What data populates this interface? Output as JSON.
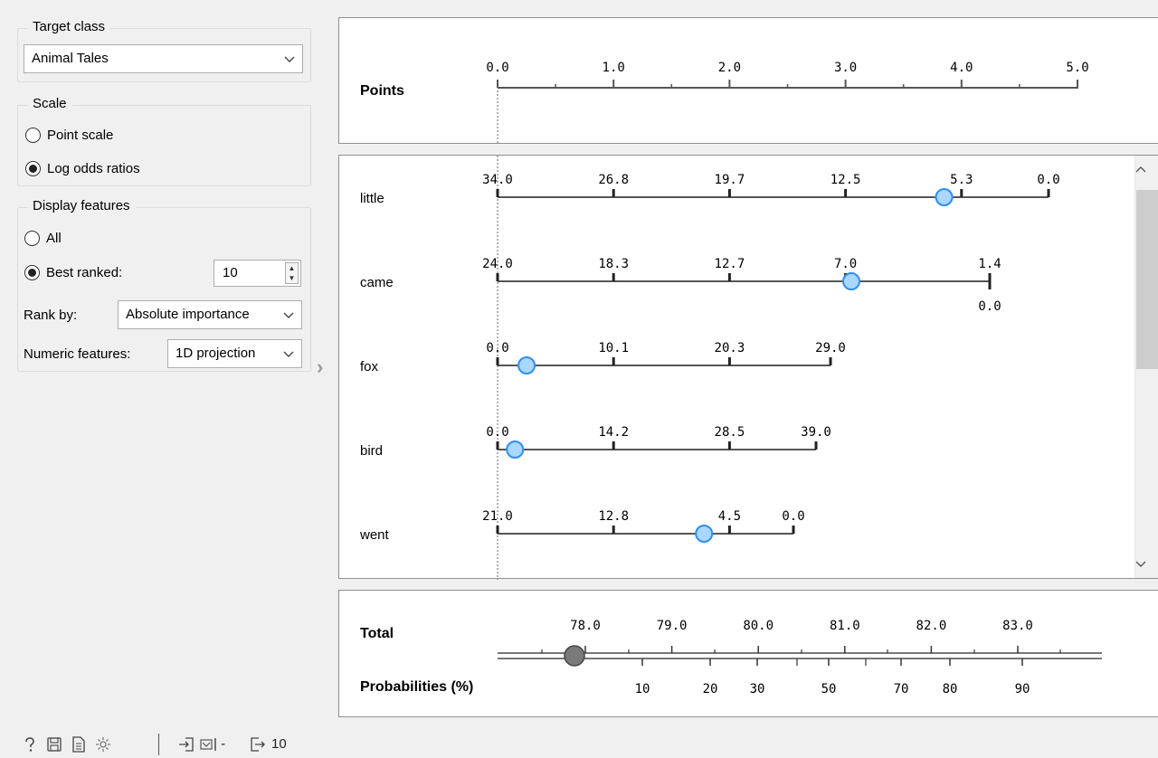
{
  "target_class": {
    "title": "Target class",
    "value": "Animal Tales"
  },
  "scale": {
    "title": "Scale",
    "options": [
      {
        "label": "Point scale",
        "checked": false
      },
      {
        "label": "Log odds ratios",
        "checked": true
      }
    ]
  },
  "display_features": {
    "title": "Display features",
    "all_label": "All",
    "best_ranked_label": "Best ranked:",
    "best_ranked_value": "10",
    "rank_by_label": "Rank by:",
    "rank_by_value": "Absolute importance",
    "numeric_label": "Numeric features:",
    "numeric_value": "1D projection"
  },
  "status_bar": {
    "input_text": "-",
    "output_count": "10"
  },
  "points_axis": {
    "label": "Points",
    "ticks": [
      "0.0",
      "1.0",
      "2.0",
      "3.0",
      "4.0",
      "5.0"
    ]
  },
  "features": [
    {
      "name": "little",
      "ticks": [
        "34.0",
        "26.8",
        "19.7",
        "12.5",
        "5.3",
        "0.0"
      ],
      "marker_point": 3.85
    },
    {
      "name": "came",
      "ticks": [
        "24.0",
        "18.3",
        "12.7",
        "7.0",
        "1.4"
      ],
      "end_label": "0.0",
      "marker_point": 3.05
    },
    {
      "name": "fox",
      "ticks": [
        "0.0",
        "10.1",
        "20.3",
        "29.0"
      ],
      "marker_point": 0.25
    },
    {
      "name": "bird",
      "ticks": [
        "0.0",
        "14.2",
        "28.5",
        "39.0"
      ],
      "marker_point": 0.15
    },
    {
      "name": "went",
      "ticks": [
        "21.0",
        "12.8",
        "4.5",
        "0.0"
      ],
      "marker_point": 1.78
    }
  ],
  "total": {
    "label": "Total",
    "ticks": [
      "78.0",
      "79.0",
      "80.0",
      "81.0",
      "82.0",
      "83.0"
    ],
    "prob_label": "Probabilities (%)",
    "prob_ticks": [
      "10",
      "20",
      "30",
      "50",
      "70",
      "80",
      "90"
    ]
  },
  "colors": {
    "marker_fill": "#a9d7ff",
    "marker_stroke": "#2f8ff0",
    "total_marker": "#7a7a7a",
    "axis": "#555555"
  }
}
